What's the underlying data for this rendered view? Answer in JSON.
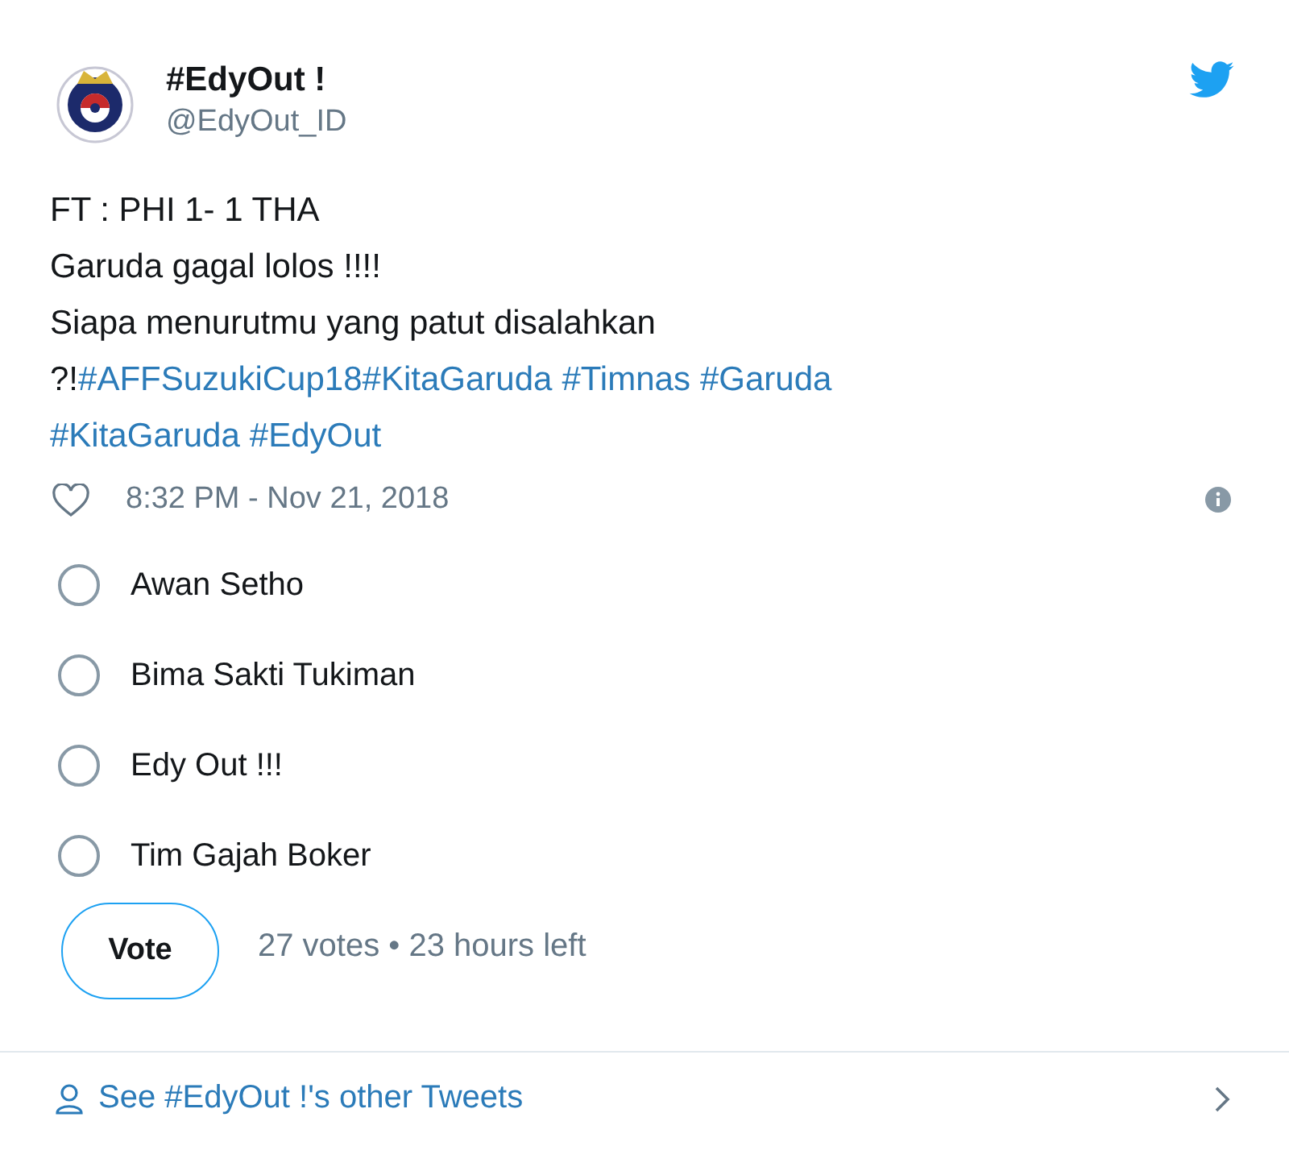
{
  "author": {
    "name": "#EdyOut !",
    "handle": "@EdyOut_ID"
  },
  "body": [
    [
      {
        "kind": "text",
        "text": "FT : PHI 1- 1 THA"
      }
    ],
    [
      {
        "kind": "text",
        "text": "Garuda gagal lolos !!!!"
      }
    ],
    [
      {
        "kind": "text",
        "text": "Siapa menurutmu yang patut disalahkan"
      }
    ],
    [
      {
        "kind": "text",
        "text": "?!"
      },
      {
        "kind": "hashtag",
        "text": "#AFFSuzukiCup18"
      },
      {
        "kind": "hashtag",
        "text": "#KitaGaruda"
      },
      {
        "kind": "space"
      },
      {
        "kind": "hashtag",
        "text": "#Timnas"
      },
      {
        "kind": "space"
      },
      {
        "kind": "hashtag",
        "text": "#Garuda"
      }
    ],
    [
      {
        "kind": "hashtag",
        "text": "#KitaGaruda"
      },
      {
        "kind": "space"
      },
      {
        "kind": "hashtag",
        "text": "#EdyOut"
      }
    ]
  ],
  "timestamp": "8:32 PM - Nov 21, 2018",
  "poll": {
    "options": [
      {
        "label": "Awan Setho",
        "selected": false
      },
      {
        "label": "Bima Sakti Tukiman",
        "selected": false
      },
      {
        "label": "Edy Out !!!",
        "selected": false
      },
      {
        "label": "Tim Gajah Boker",
        "selected": false
      }
    ],
    "button": "Vote",
    "summary": "27 votes • 23 hours left"
  },
  "footer": {
    "link": "See #EdyOut !'s other Tweets"
  }
}
